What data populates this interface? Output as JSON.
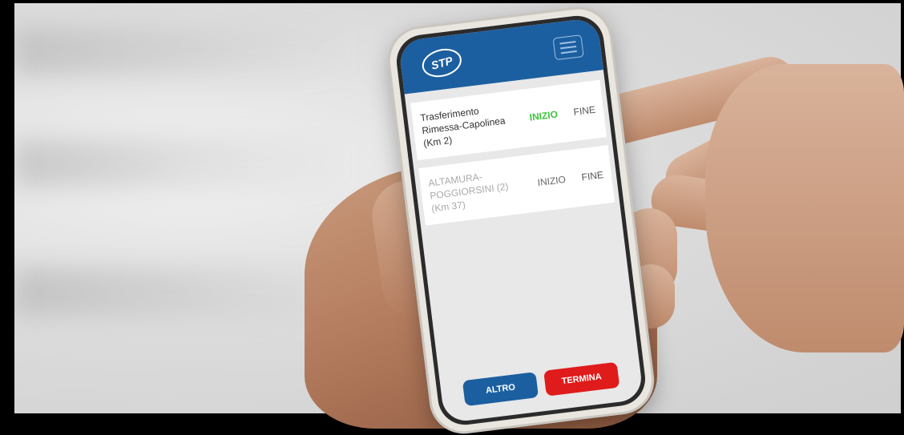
{
  "app": {
    "logo_text": "STP",
    "brand_color": "#1c5fa0",
    "menu_icon": "hamburger-menu-icon"
  },
  "trips": [
    {
      "label_line1": "Trasferimento",
      "label_line2": "Rimessa-Capolinea",
      "label_line3": "(Km 2)",
      "start_label": "INIZIO",
      "end_label": "FINE",
      "state": "active"
    },
    {
      "label_line1": "ALTAMURA-",
      "label_line2": "POGGIORSINI (2)",
      "label_line3": "(Km 37)",
      "start_label": "INIZIO",
      "end_label": "FINE",
      "state": "inactive"
    }
  ],
  "footer": {
    "other_label": "ALTRO",
    "end_label": "TERMINA",
    "other_color": "#1c5fa0",
    "end_color": "#e01b1b"
  }
}
